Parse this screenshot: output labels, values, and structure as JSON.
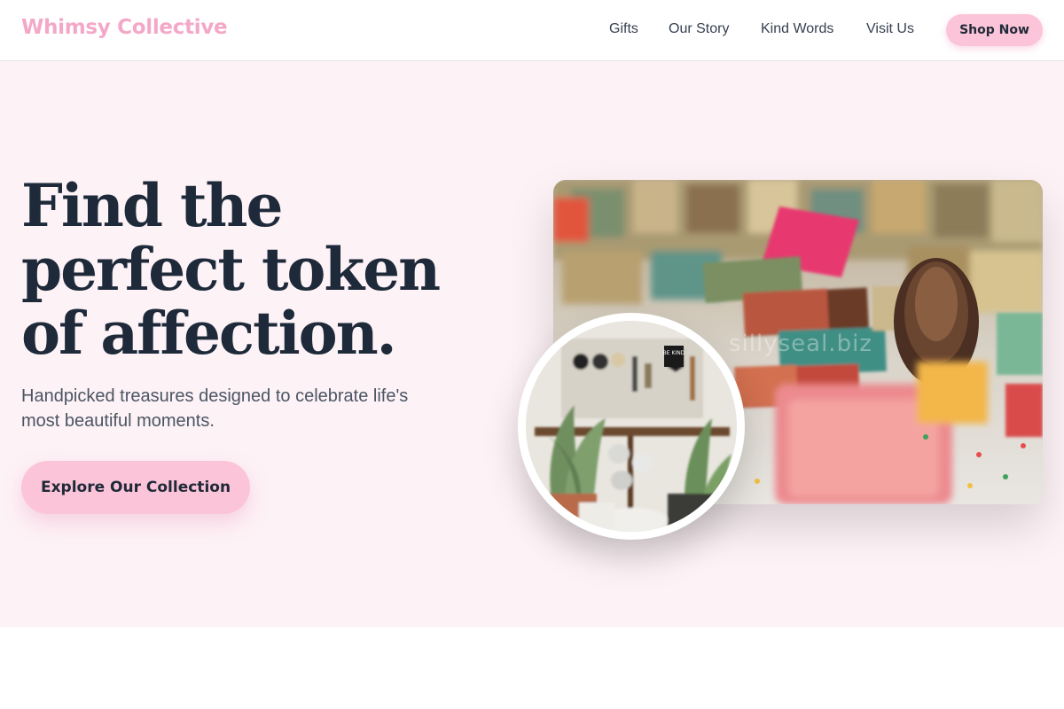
{
  "header": {
    "brand": "Whimsy Collective",
    "nav": [
      "Gifts",
      "Our Story",
      "Kind Words",
      "Visit Us"
    ],
    "cta_label": "Shop Now"
  },
  "hero": {
    "headline": "Find the perfect token of affection.",
    "subtext": "Handpicked treasures designed to celebrate life's most beautiful moments.",
    "cta_label": "Explore Our Collection",
    "main_image": {
      "description_icon": "soap-bars-photo",
      "watermark": "sillyseal.biz"
    },
    "inset_image": {
      "description_icon": "plants-shop-photo",
      "sign_text": "BE KIND"
    }
  },
  "colors": {
    "brand": "#f4a8c8",
    "button": "#fbc4d9",
    "hero_bg": "#fdf2f6",
    "headline": "#1e2a3a"
  }
}
